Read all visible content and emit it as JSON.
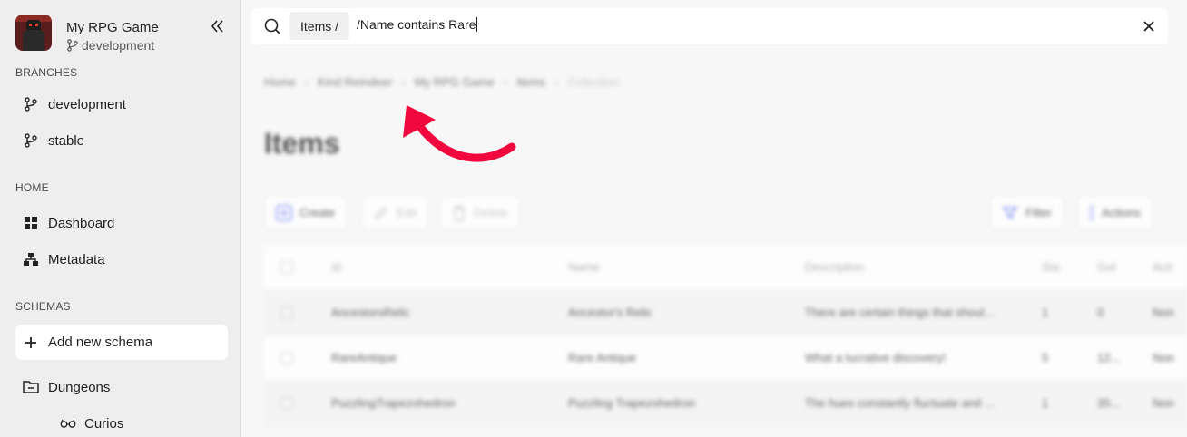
{
  "project": {
    "name": "My RPG Game",
    "branch": "development"
  },
  "sidebar": {
    "sections": {
      "branches": "BRANCHES",
      "home": "HOME",
      "schemas": "SCHEMAS"
    },
    "branches": [
      {
        "label": "development"
      },
      {
        "label": "stable"
      }
    ],
    "home": [
      {
        "label": "Dashboard"
      },
      {
        "label": "Metadata"
      }
    ],
    "add_schema": "Add new schema",
    "folders": [
      {
        "label": "Dungeons"
      }
    ],
    "schemas": [
      {
        "label": "Curios"
      }
    ]
  },
  "search": {
    "scope": "Items /",
    "query": "/Name contains Rare"
  },
  "background": {
    "breadcrumbs": [
      "Home",
      "Kind Reindeer",
      "My RPG Game",
      "Items",
      "Collection"
    ],
    "title": "Items",
    "toolbar": {
      "create": "Create",
      "edit": "Edit",
      "delete": "Delete",
      "filter": "Filter",
      "actions": "Actions"
    },
    "table": {
      "columns": [
        "Id",
        "Name",
        "Description",
        "Sta",
        "Gol",
        "Acti"
      ],
      "rows": [
        [
          "AncestorsRelic",
          "Ancestor's Relic",
          "There are certain things that shoul...",
          "1",
          "0",
          "Non"
        ],
        [
          "RareAntique",
          "Rare Antique",
          "What a lucrative discovery!",
          "5",
          "12...",
          "Non"
        ],
        [
          "PuzzlingTrapezohedron",
          "Puzzling Trapezohedron",
          "The hues constantly fluctuate and ...",
          "1",
          "35...",
          "Non"
        ]
      ]
    }
  },
  "colors": {
    "accent": "#f0083f",
    "sidebar_bg": "#eeeeee",
    "icon_blue": "#5b6cf0"
  }
}
